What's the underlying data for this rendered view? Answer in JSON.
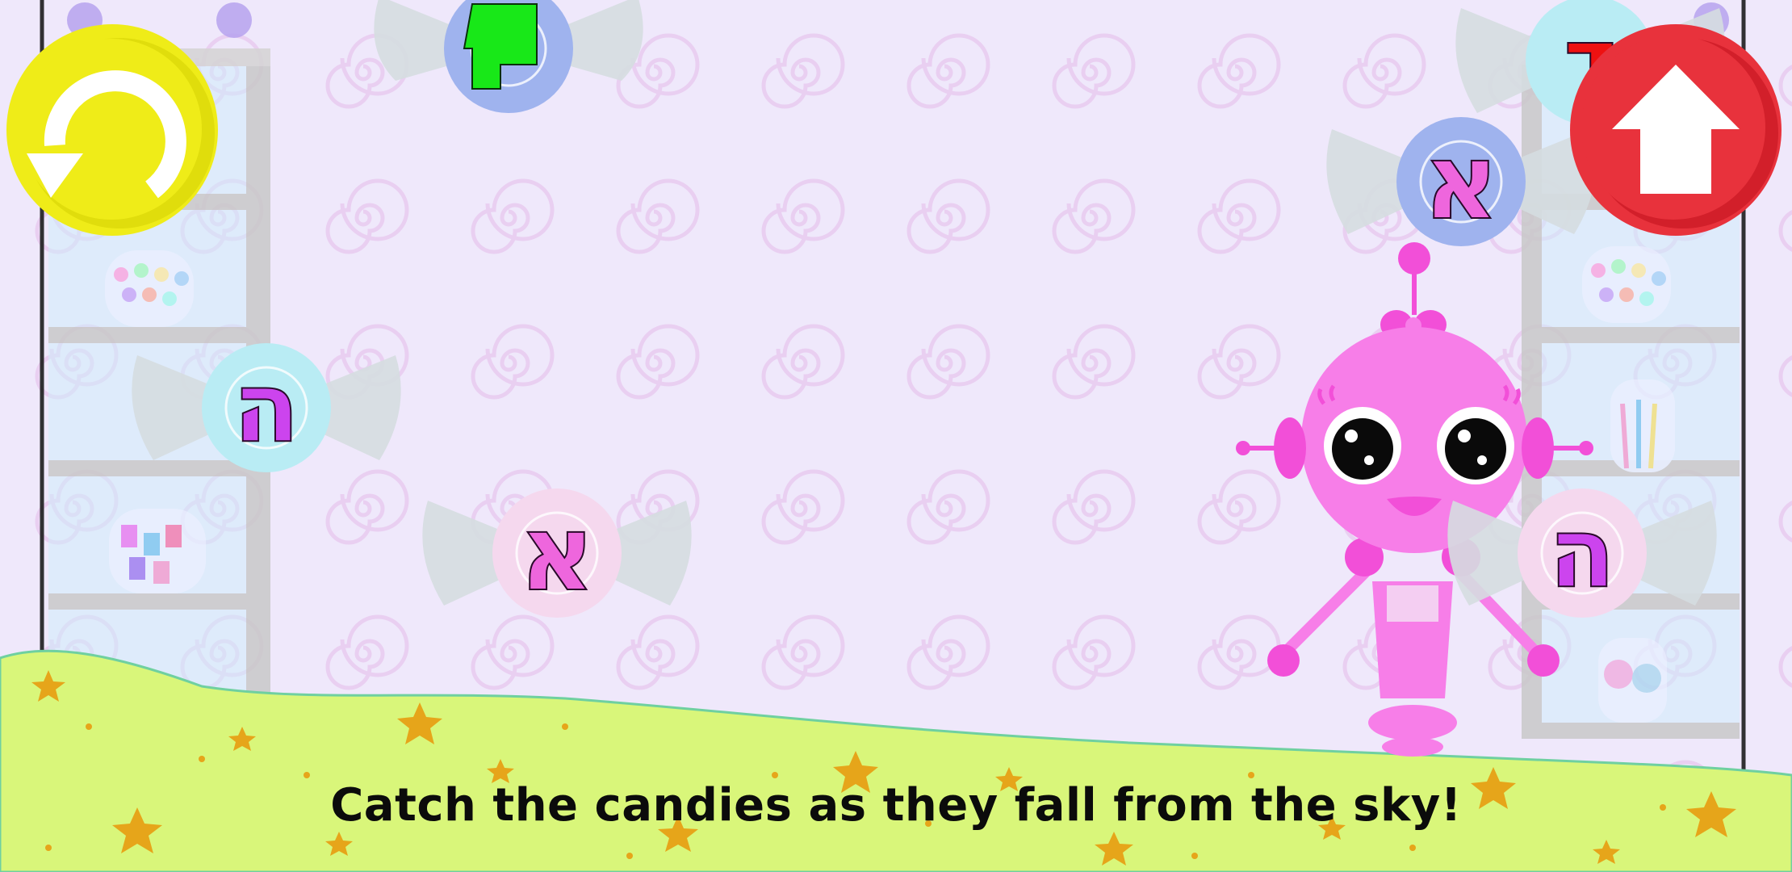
{
  "game": {
    "instruction": "Catch the candies as they fall from the sky!",
    "controls": {
      "replay": {
        "icon": "replay-arrow-icon",
        "color": "#efec18"
      },
      "home": {
        "icon": "up-arrow-home-icon",
        "color": "#e8323c"
      }
    },
    "candies": [
      {
        "letter": "",
        "wrapper_color": "#9fb3ee",
        "letter_color": "#18e818",
        "shape": "green-block"
      },
      {
        "letter": "ה",
        "wrapper_color": "#b9ecf4",
        "letter_color": "#cc44ee"
      },
      {
        "letter": "א",
        "wrapper_color": "#f5d8ee",
        "letter_color": "#ee66dd"
      },
      {
        "letter": "א",
        "wrapper_color": "#9fb3ee",
        "letter_color": "#ee66dd"
      },
      {
        "letter": "ה",
        "wrapper_color": "#f5d8ee",
        "letter_color": "#cc44ee"
      },
      {
        "letter": "ד",
        "wrapper_color": "#b9ecf4",
        "letter_color": "#ee1111"
      }
    ],
    "character": {
      "name": "pink-robot",
      "color": "#f77ee8"
    },
    "colors": {
      "background": "#efe8fb",
      "ground": "#d9f67a",
      "stars": "#e6a51a"
    }
  }
}
